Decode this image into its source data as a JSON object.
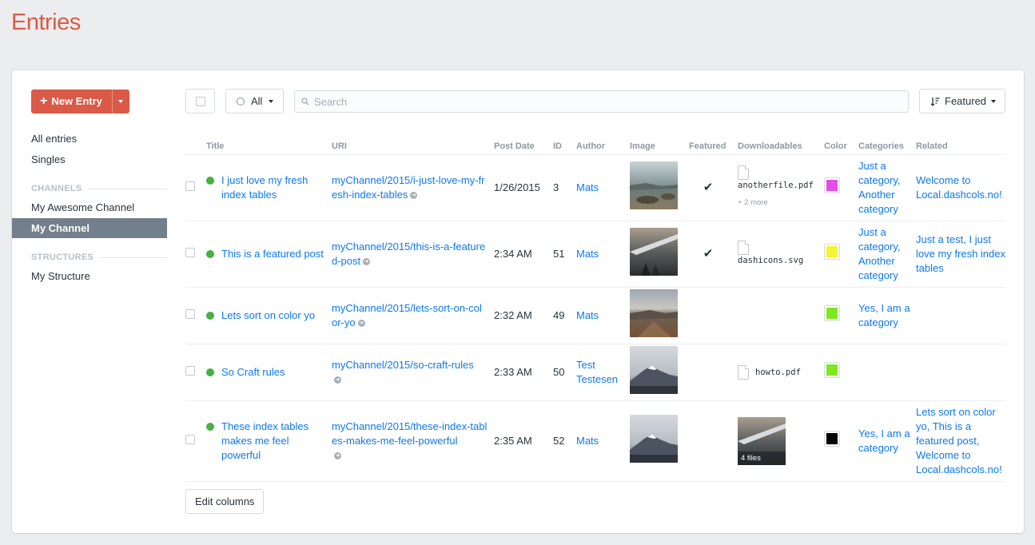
{
  "page_title": "Entries",
  "sidebar": {
    "new_entry_label": "New Entry",
    "items_top": [
      {
        "label": "All entries"
      },
      {
        "label": "Singles"
      }
    ],
    "channels_heading": "CHANNELS",
    "channels": [
      {
        "label": "My Awesome Channel"
      },
      {
        "label": "My Channel",
        "selected": true
      }
    ],
    "structures_heading": "STRUCTURES",
    "structures": [
      {
        "label": "My Structure"
      }
    ]
  },
  "toolbar": {
    "status_label": "All",
    "search_placeholder": "Search",
    "sort_label": "Featured"
  },
  "table": {
    "headers": [
      "Title",
      "URI",
      "Post Date",
      "ID",
      "Author",
      "Image",
      "Featured",
      "Downloadables",
      "Color",
      "Categories",
      "Related"
    ],
    "rows": [
      {
        "title": "I just love my fresh index tables",
        "uri": "myChannel/2015/i-just-love-my-fresh-index-tables",
        "post_date": "1/26/2015",
        "id": "3",
        "author": "Mats",
        "featured": "✔",
        "downloads": [
          {
            "name": "anotherfile.pdf"
          }
        ],
        "downloads_more": "+ 2 more",
        "color": "#e64ce6",
        "categories": "Just a category, Another category",
        "related": "Welcome to Local.dashcols.no!"
      },
      {
        "title": "This is a featured post",
        "uri": "myChannel/2015/this-is-a-featured-post",
        "post_date": "2:34 AM",
        "id": "51",
        "author": "Mats",
        "featured": "✔",
        "downloads": [
          {
            "name": "dashicons.svg"
          }
        ],
        "downloads_more": "",
        "color": "#f5f531",
        "categories": "Just a category, Another category",
        "related": "Just a test, I just love my fresh index tables"
      },
      {
        "title": "Lets sort on color yo",
        "uri": "myChannel/2015/lets-sort-on-color-yo",
        "post_date": "2:32 AM",
        "id": "49",
        "author": "Mats",
        "featured": "",
        "downloads": [],
        "downloads_more": "",
        "color": "#7de81e",
        "categories": "Yes, I am a category",
        "related": ""
      },
      {
        "title": "So Craft rules",
        "uri": "myChannel/2015/so-craft-rules",
        "post_date": "2:33 AM",
        "id": "50",
        "author": "Test Testesen",
        "featured": "",
        "downloads": [
          {
            "name": "howto.pdf"
          }
        ],
        "downloads_more": "",
        "color": "#7de81e",
        "categories": "",
        "related": ""
      },
      {
        "title": "These index tables makes me feel powerful",
        "uri": "myChannel/2015/these-index-tables-makes-me-feel-powerful",
        "post_date": "2:35 AM",
        "id": "52",
        "author": "Mats",
        "featured": "",
        "downloads": [],
        "downloads_files_label": "4 files",
        "downloads_more": "",
        "color": "#000000",
        "categories": "Yes, I am a category",
        "related": "Lets sort on color yo, This is a featured post, Welcome to Local.dashcols.no!"
      }
    ]
  },
  "edit_columns_label": "Edit columns",
  "colors": {
    "accent": "#da5a47",
    "link": "#0d78f2",
    "status_live": "#46b041",
    "selected_nav": "#737f8c"
  }
}
